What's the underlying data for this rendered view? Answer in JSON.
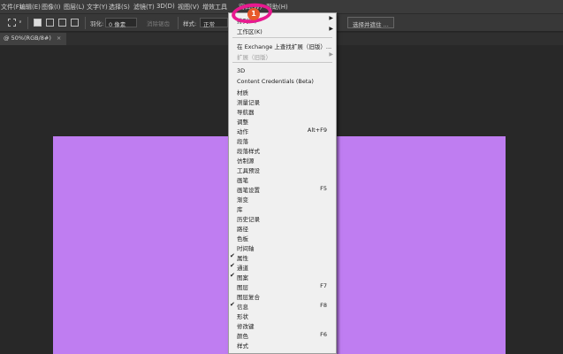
{
  "menubar": {
    "items": [
      "文件(F)",
      "编辑(E)",
      "图像(I)",
      "图层(L)",
      "文字(Y)",
      "选择(S)",
      "滤镜(T)",
      "3D(D)",
      "视图(V)",
      "增效工具",
      "窗口(W)",
      "帮助(H)"
    ]
  },
  "options": {
    "feather_label": "羽化:",
    "feather_value": "0 像素",
    "antialias_label": "消除锯齿",
    "style_label": "样式:",
    "style_value": "正常",
    "select_subject_button": "选择并遮住 ..."
  },
  "document": {
    "tab_label": "@ 50%(RGB/8#)",
    "close_glyph": "×",
    "canvas_color": "#bf7df1"
  },
  "dropdown": {
    "items": [
      {
        "label": "排列(A)",
        "submenu": true
      },
      {
        "label": "工作区(K)",
        "submenu": true
      },
      {
        "label": "在 Exchange 上查找扩展（旧版）..."
      },
      {
        "label": "扩展（旧版）",
        "disabled": true,
        "submenu": true
      },
      {
        "label": "3D"
      },
      {
        "label": "Content Credentials (Beta)"
      },
      {
        "label": "材质"
      },
      {
        "label": "测量记录"
      },
      {
        "label": "导航器"
      },
      {
        "label": "调整"
      },
      {
        "label": "动作",
        "shortcut": "Alt+F9"
      },
      {
        "label": "段落"
      },
      {
        "label": "段落样式"
      },
      {
        "label": "仿制源"
      },
      {
        "label": "工具预设"
      },
      {
        "label": "画笔"
      },
      {
        "label": "画笔设置",
        "shortcut": "F5"
      },
      {
        "label": "渐变"
      },
      {
        "label": "库"
      },
      {
        "label": "历史记录"
      },
      {
        "label": "路径"
      },
      {
        "label": "色板"
      },
      {
        "label": "时间轴"
      },
      {
        "label": "属性",
        "checked": true
      },
      {
        "label": "通道",
        "checked": true
      },
      {
        "label": "图案",
        "checked": true
      },
      {
        "label": "图层",
        "shortcut": "F7"
      },
      {
        "label": "图层复合"
      },
      {
        "label": "信息",
        "shortcut": "F8",
        "checked": true
      },
      {
        "label": "形状"
      },
      {
        "label": "修改键"
      },
      {
        "label": "颜色",
        "shortcut": "F6"
      },
      {
        "label": "样式"
      }
    ]
  },
  "annotation": {
    "step_number": "1",
    "highlight_color": "#e8198f",
    "badge_color": "#e85a2b"
  }
}
